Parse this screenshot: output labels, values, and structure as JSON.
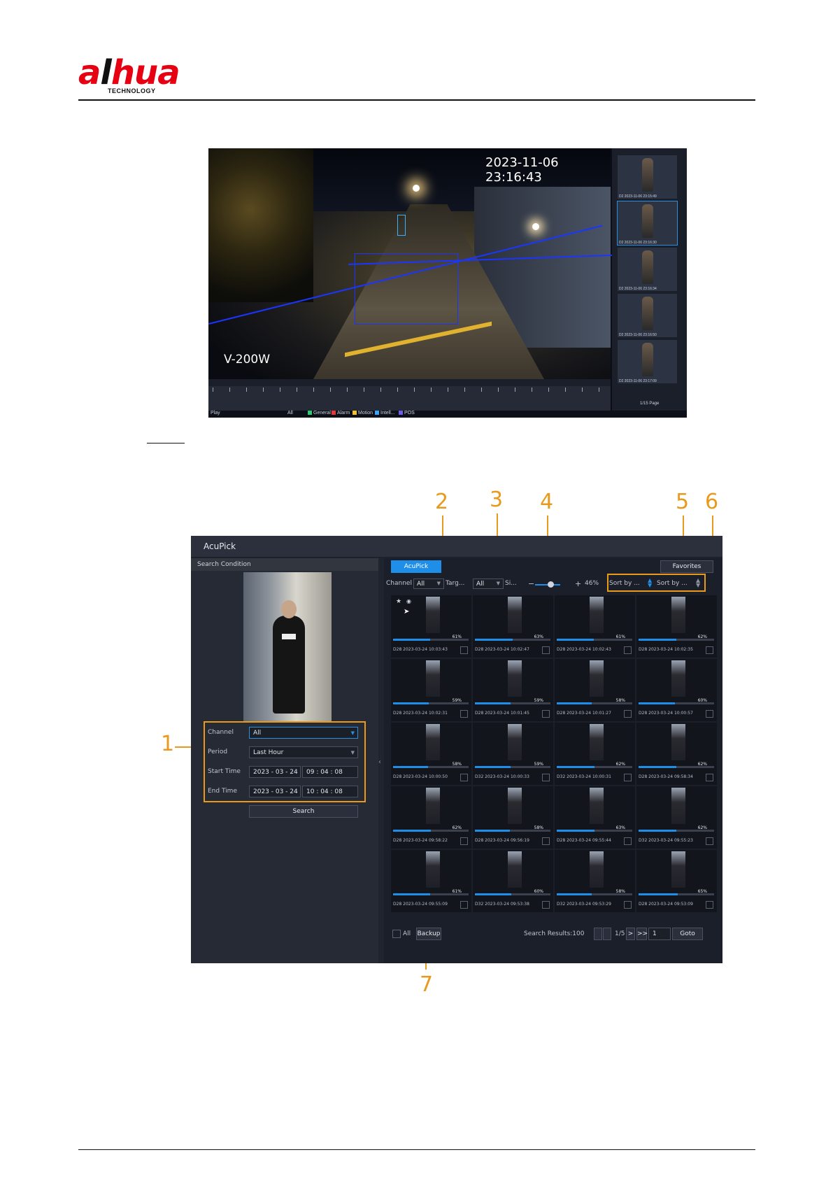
{
  "logo": {
    "brand_a": "a",
    "brand_rest": "hua",
    "brand_l": "l",
    "subtitle": "TECHNOLOGY"
  },
  "figure1": {
    "timestamp": "2023-11-06 23:16:43",
    "camera_name": "V-200W",
    "status_left": "Play",
    "filter_all": "All",
    "legend": [
      {
        "label": "General",
        "color": "#2ecc71"
      },
      {
        "label": "Alarm",
        "color": "#e53935"
      },
      {
        "label": "Motion",
        "color": "#f2c230"
      },
      {
        "label": "Intell...",
        "color": "#3ba3f5"
      },
      {
        "label": "POS",
        "color": "#6c5ce7"
      }
    ],
    "thumbnails": [
      {
        "caption": "D2 2023-11-06 23:15:49"
      },
      {
        "caption": "D2 2023-11-06 23:16:30"
      },
      {
        "caption": "D2 2023-11-06 23:16:34"
      },
      {
        "caption": "D2 2023-11-06 23:16:50"
      },
      {
        "caption": "D2 2023-11-06 23:17:09"
      }
    ],
    "page_indicator": "1/15 Page"
  },
  "callouts": {
    "n1": "1",
    "n2": "2",
    "n3": "3",
    "n4": "4",
    "n5": "5",
    "n6": "6",
    "n7": "7"
  },
  "acupick": {
    "title": "AcuPick",
    "left": {
      "header": "Search Condition",
      "channel_label": "Channel",
      "channel_value": "All",
      "period_label": "Period",
      "period_value": "Last Hour",
      "start_label": "Start Time",
      "start_date": "2023 - 03 - 24",
      "start_time": "09 : 04 : 08",
      "end_label": "End Time",
      "end_date": "2023 - 03 - 24",
      "end_time": "10 : 04 : 08",
      "search_button": "Search"
    },
    "right": {
      "tab": "AcuPick",
      "favorites": "Favorites",
      "channel_label": "Channel",
      "channel_value": "All",
      "target_label": "Targ...",
      "target_value": "All",
      "sim_label": "Si...",
      "zoom_minus": "−",
      "zoom_plus": "+",
      "zoom_value": "46%",
      "sort1": "Sort by ...",
      "sort2": "Sort by ...",
      "results": [
        {
          "pct": "61%",
          "cap": "D28 2023-03-24 10:03:43",
          "level": 0.61
        },
        {
          "pct": "63%",
          "cap": "D28 2023-03-24 10:02:47",
          "level": 0.63
        },
        {
          "pct": "61%",
          "cap": "D28 2023-03-24 10:02:43",
          "level": 0.61
        },
        {
          "pct": "62%",
          "cap": "D28 2023-03-24 10:02:35",
          "level": 0.62
        },
        {
          "pct": "59%",
          "cap": "D28 2023-03-24 10:02:31",
          "level": 0.59
        },
        {
          "pct": "59%",
          "cap": "D28 2023-03-24 10:01:45",
          "level": 0.59
        },
        {
          "pct": "58%",
          "cap": "D28 2023-03-24 10:01:27",
          "level": 0.58
        },
        {
          "pct": "60%",
          "cap": "D28 2023-03-24 10:00:57",
          "level": 0.6
        },
        {
          "pct": "58%",
          "cap": "D28 2023-03-24 10:00:50",
          "level": 0.58
        },
        {
          "pct": "59%",
          "cap": "D32 2023-03-24 10:00:33",
          "level": 0.59
        },
        {
          "pct": "62%",
          "cap": "D32 2023-03-24 10:00:31",
          "level": 0.62
        },
        {
          "pct": "62%",
          "cap": "D28 2023-03-24 09:58:34",
          "level": 0.62
        },
        {
          "pct": "62%",
          "cap": "D28 2023-03-24 09:58:22",
          "level": 0.62
        },
        {
          "pct": "58%",
          "cap": "D28 2023-03-24 09:56:19",
          "level": 0.58
        },
        {
          "pct": "63%",
          "cap": "D28 2023-03-24 09:55:44",
          "level": 0.63
        },
        {
          "pct": "62%",
          "cap": "D32 2023-03-24 09:55:23",
          "level": 0.62
        },
        {
          "pct": "61%",
          "cap": "D28 2023-03-24 09:55:09",
          "level": 0.61
        },
        {
          "pct": "60%",
          "cap": "D32 2023-03-24 09:53:38",
          "level": 0.6
        },
        {
          "pct": "58%",
          "cap": "D32 2023-03-24 09:53:29",
          "level": 0.58
        },
        {
          "pct": "65%",
          "cap": "D28 2023-03-24 09:53:09",
          "level": 0.65
        }
      ],
      "select_all": "All",
      "backup": "Backup",
      "search_results": "Search Results:100",
      "page": "1/5",
      "next": ">",
      "last": ">>",
      "goto_value": "1",
      "goto": "Goto"
    }
  }
}
